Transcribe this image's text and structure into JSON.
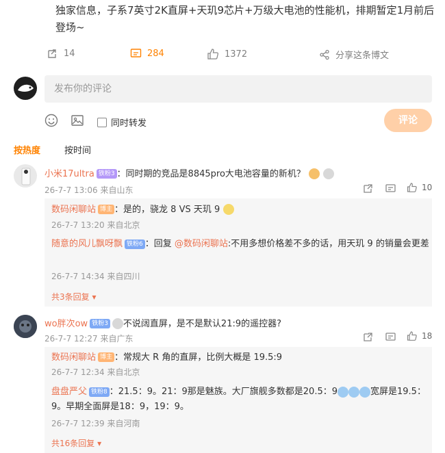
{
  "post": {
    "text": "独家信息，子系7英寸2K直屏+天玑9芯片+万级大电池的性能机，排期暂定1月前后登场~",
    "repost_count": "14",
    "comment_count": "284",
    "like_count": "1372",
    "share_label": "分享这条博文"
  },
  "composer": {
    "placeholder": "发布你的评论",
    "repost_label": "同时转发",
    "submit_label": "评论"
  },
  "sort": {
    "hot": "按热度",
    "time": "按时间"
  },
  "comments": [
    {
      "user": "小米17ultra",
      "badge": "铁粉3",
      "text": "：同时期的竞品是8845pro大电池容量的新机？",
      "time": "26-7-7 13:06",
      "location": "来自山东",
      "likes": "10",
      "replies": [
        {
          "user": "数码闲聊站",
          "badge": "博主",
          "text": "：是的，骁龙 8 VS 天玑 9",
          "time": "26-7-7 13:20",
          "location": "来自北京"
        },
        {
          "user": "随意的风儿飘呀飘",
          "badge": "铁粉6",
          "reply_prefix": "：回复 ",
          "mention": "@数码闲聊站",
          "text": ":不用多想价格差不多的话，用天玑 9 的销量会更差",
          "time": "26-7-7 14:34",
          "location": "来自四川"
        }
      ],
      "more": "共3条回复"
    },
    {
      "user": "wo胖次ow",
      "badge": "铁粉3",
      "text": "不说阔直屏，是不是默认21:9的遥控器?",
      "time": "26-7-7 12:27",
      "location": "来自广东",
      "likes": "18",
      "replies": [
        {
          "user": "数码闲聊站",
          "badge": "博主",
          "text": "：常规大 R 角的直屏，比例大概是 19.5:9",
          "time": "26-7-7 12:34",
          "location": "来自北京"
        },
        {
          "user": "盘盘严父",
          "badge": "铁粉8",
          "text": "：21.5：9。21：9那是魅族。大厂旗舰多数都是20.5：9",
          "text_tail": "宽屏是19.5：9。早期全面屏是18：9，19：9。",
          "time": "26-7-7 12:39",
          "location": "来自河南"
        }
      ],
      "more": "共16条回复"
    }
  ],
  "colors": {
    "accent": "#ff8200",
    "username": "#eb7350",
    "meta": "#999999"
  }
}
